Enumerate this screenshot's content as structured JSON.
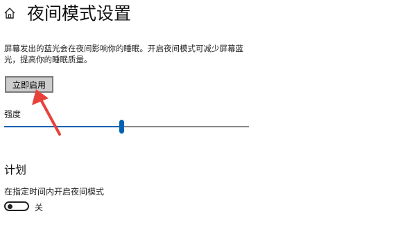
{
  "header": {
    "title": "夜间模式设置",
    "home_icon": "home-icon"
  },
  "description": "屏幕发出的蓝光会在夜间影响你的睡眠。开启夜间模式可减少屏幕蓝光，提高你的睡眠质量。",
  "enable_button": {
    "label": "立即启用"
  },
  "strength": {
    "label": "强度",
    "value_fraction": 0.48
  },
  "schedule": {
    "title": "计划",
    "toggle_label": "在指定时间内开启夜间模式",
    "toggle_state": "关"
  },
  "colors": {
    "accent": "#0063b1",
    "annotation_arrow": "#e8413b"
  }
}
